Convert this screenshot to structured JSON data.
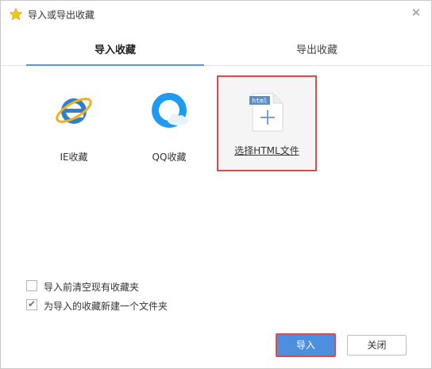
{
  "window": {
    "title": "导入或导出收藏",
    "close_icon": "close-icon",
    "star_icon": "star-icon"
  },
  "tabs": [
    {
      "label": "导入收藏",
      "active": true
    },
    {
      "label": "导出收藏",
      "active": false
    }
  ],
  "options": {
    "ie": {
      "label": "IE收藏",
      "icon": "ie-icon"
    },
    "qq": {
      "label": "QQ收藏",
      "icon": "qq-browser-icon"
    },
    "html": {
      "label": "选择HTML文件",
      "icon": "html-file-add-icon",
      "badge": "html"
    }
  },
  "checkboxes": [
    {
      "label": "导入前清空现有收藏夹",
      "checked": false
    },
    {
      "label": "为导入的收藏新建一个文件夹",
      "checked": true
    }
  ],
  "buttons": {
    "import": "导入",
    "close": "关闭"
  },
  "colors": {
    "accent": "#4d8fde",
    "highlight": "#e04a4a",
    "tab_underline": "#5b9bd5"
  }
}
